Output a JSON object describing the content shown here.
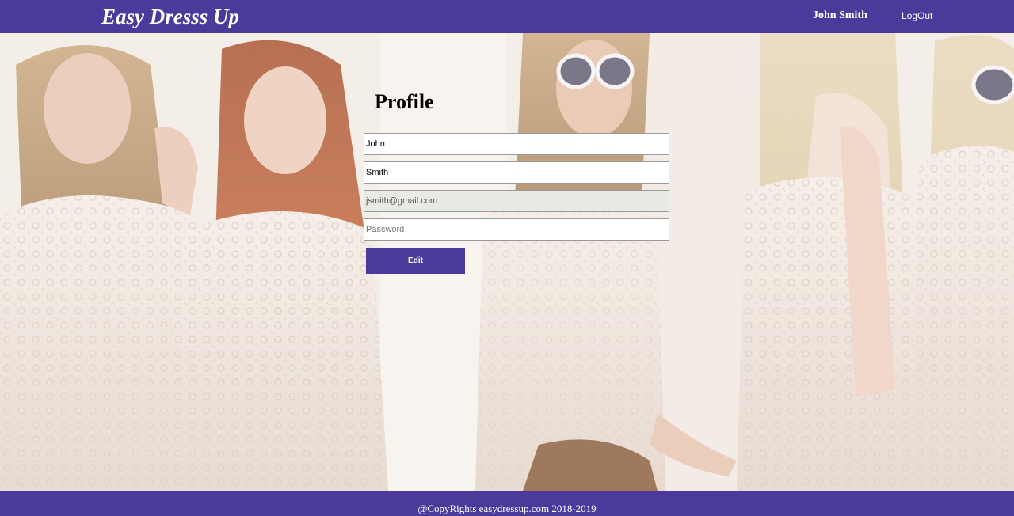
{
  "header": {
    "brand": "Easy Dresss Up",
    "user_name": "John Smith",
    "logout_label": "LogOut"
  },
  "profile": {
    "title": "Profile",
    "first_name": {
      "value": "John"
    },
    "last_name": {
      "value": "Smith"
    },
    "email": {
      "value": "jsmith@gmail.com"
    },
    "password": {
      "value": "",
      "placeholder": "Password"
    },
    "edit_label": "Edit"
  },
  "footer": {
    "copyright": "@CopyRights easydressup.com 2018-2019"
  },
  "colors": {
    "brand": "#4b3a9b",
    "disabled_field": "#e8ebe4"
  }
}
